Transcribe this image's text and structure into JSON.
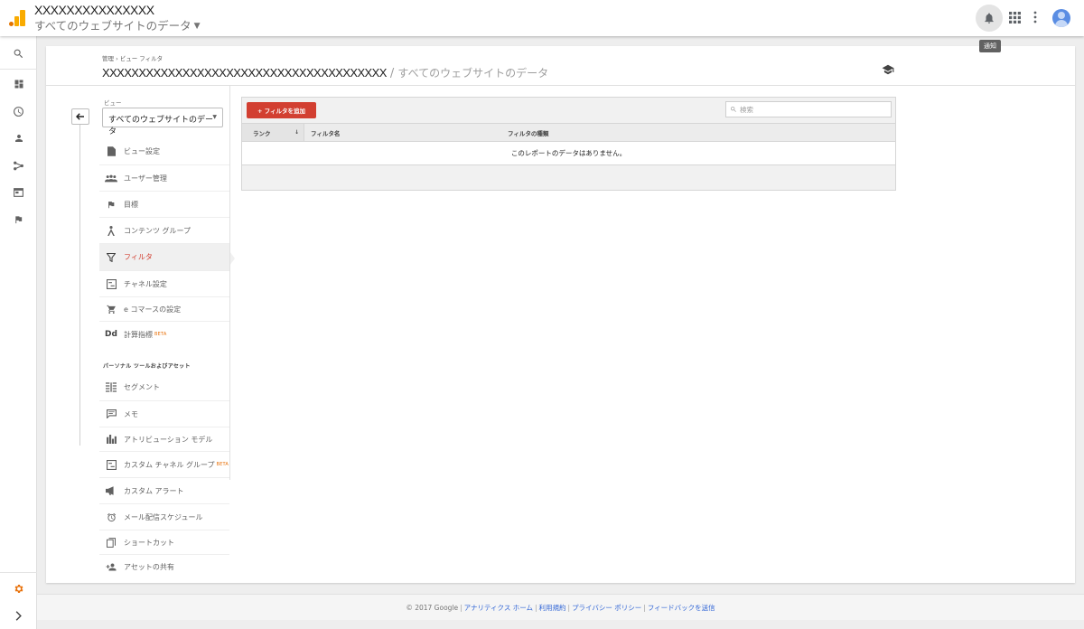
{
  "header": {
    "account_name": "XXXXXXXXXXXXXXX",
    "view_name": "すべてのウェブサイトのデータ",
    "notification_tooltip": "通知"
  },
  "page": {
    "breadcrumb": "管理 › ビュー フィルタ",
    "property_name": "XXXXXXXXXXXXXXXXXXXXXXXXXXXXXXXXXXXXXXX",
    "title_separator": " / ",
    "view_name": "すべてのウェブサイトのデータ"
  },
  "view_selector": {
    "label": "ビュー",
    "selected": "すべてのウェブサイトのデータ"
  },
  "nav": {
    "items": [
      {
        "label": "ビュー設定",
        "icon": "document-icon"
      },
      {
        "label": "ユーザー管理",
        "icon": "people-icon"
      },
      {
        "label": "目標",
        "icon": "flag-icon"
      },
      {
        "label": "コンテンツ グループ",
        "icon": "person-walk-icon"
      },
      {
        "label": "フィルタ",
        "icon": "filter-icon",
        "active": true
      },
      {
        "label": "チャネル設定",
        "icon": "channel-icon"
      },
      {
        "label": "e コマースの設定",
        "icon": "cart-icon"
      },
      {
        "label": "計算指標",
        "icon": "dd-icon",
        "badge": "BETA"
      }
    ],
    "section_label": "パーソナル ツールおよびアセット",
    "personal_items": [
      {
        "label": "セグメント",
        "icon": "segment-icon"
      },
      {
        "label": "メモ",
        "icon": "comment-icon"
      },
      {
        "label": "アトリビューション モデル",
        "icon": "bar-chart-icon"
      },
      {
        "label": "カスタム チャネル グループ",
        "icon": "channel-icon",
        "badge": "BETA"
      },
      {
        "label": "カスタム アラート",
        "icon": "megaphone-icon"
      },
      {
        "label": "メール配信スケジュール",
        "icon": "alarm-icon"
      },
      {
        "label": "ショートカット",
        "icon": "copy-icon"
      },
      {
        "label": "アセットの共有",
        "icon": "person-add-icon"
      }
    ]
  },
  "table": {
    "add_button": "+ フィルタを追加",
    "search_placeholder": "検索",
    "columns": {
      "rank": "ランク",
      "name": "フィルタ名",
      "type": "フィルタの種類"
    },
    "sort_indicator": "↓",
    "empty_message": "このレポートのデータはありません。"
  },
  "footer": {
    "copyright": "© 2017 Google",
    "links": [
      "アナリティクス ホーム",
      "利用規約",
      "プライバシー ポリシー",
      "フィードバックを送信"
    ]
  },
  "colors": {
    "accent_red": "#d23f31",
    "beta_orange": "#e8710a",
    "settings_orange": "#e8710a",
    "link_blue": "#3367d6"
  }
}
